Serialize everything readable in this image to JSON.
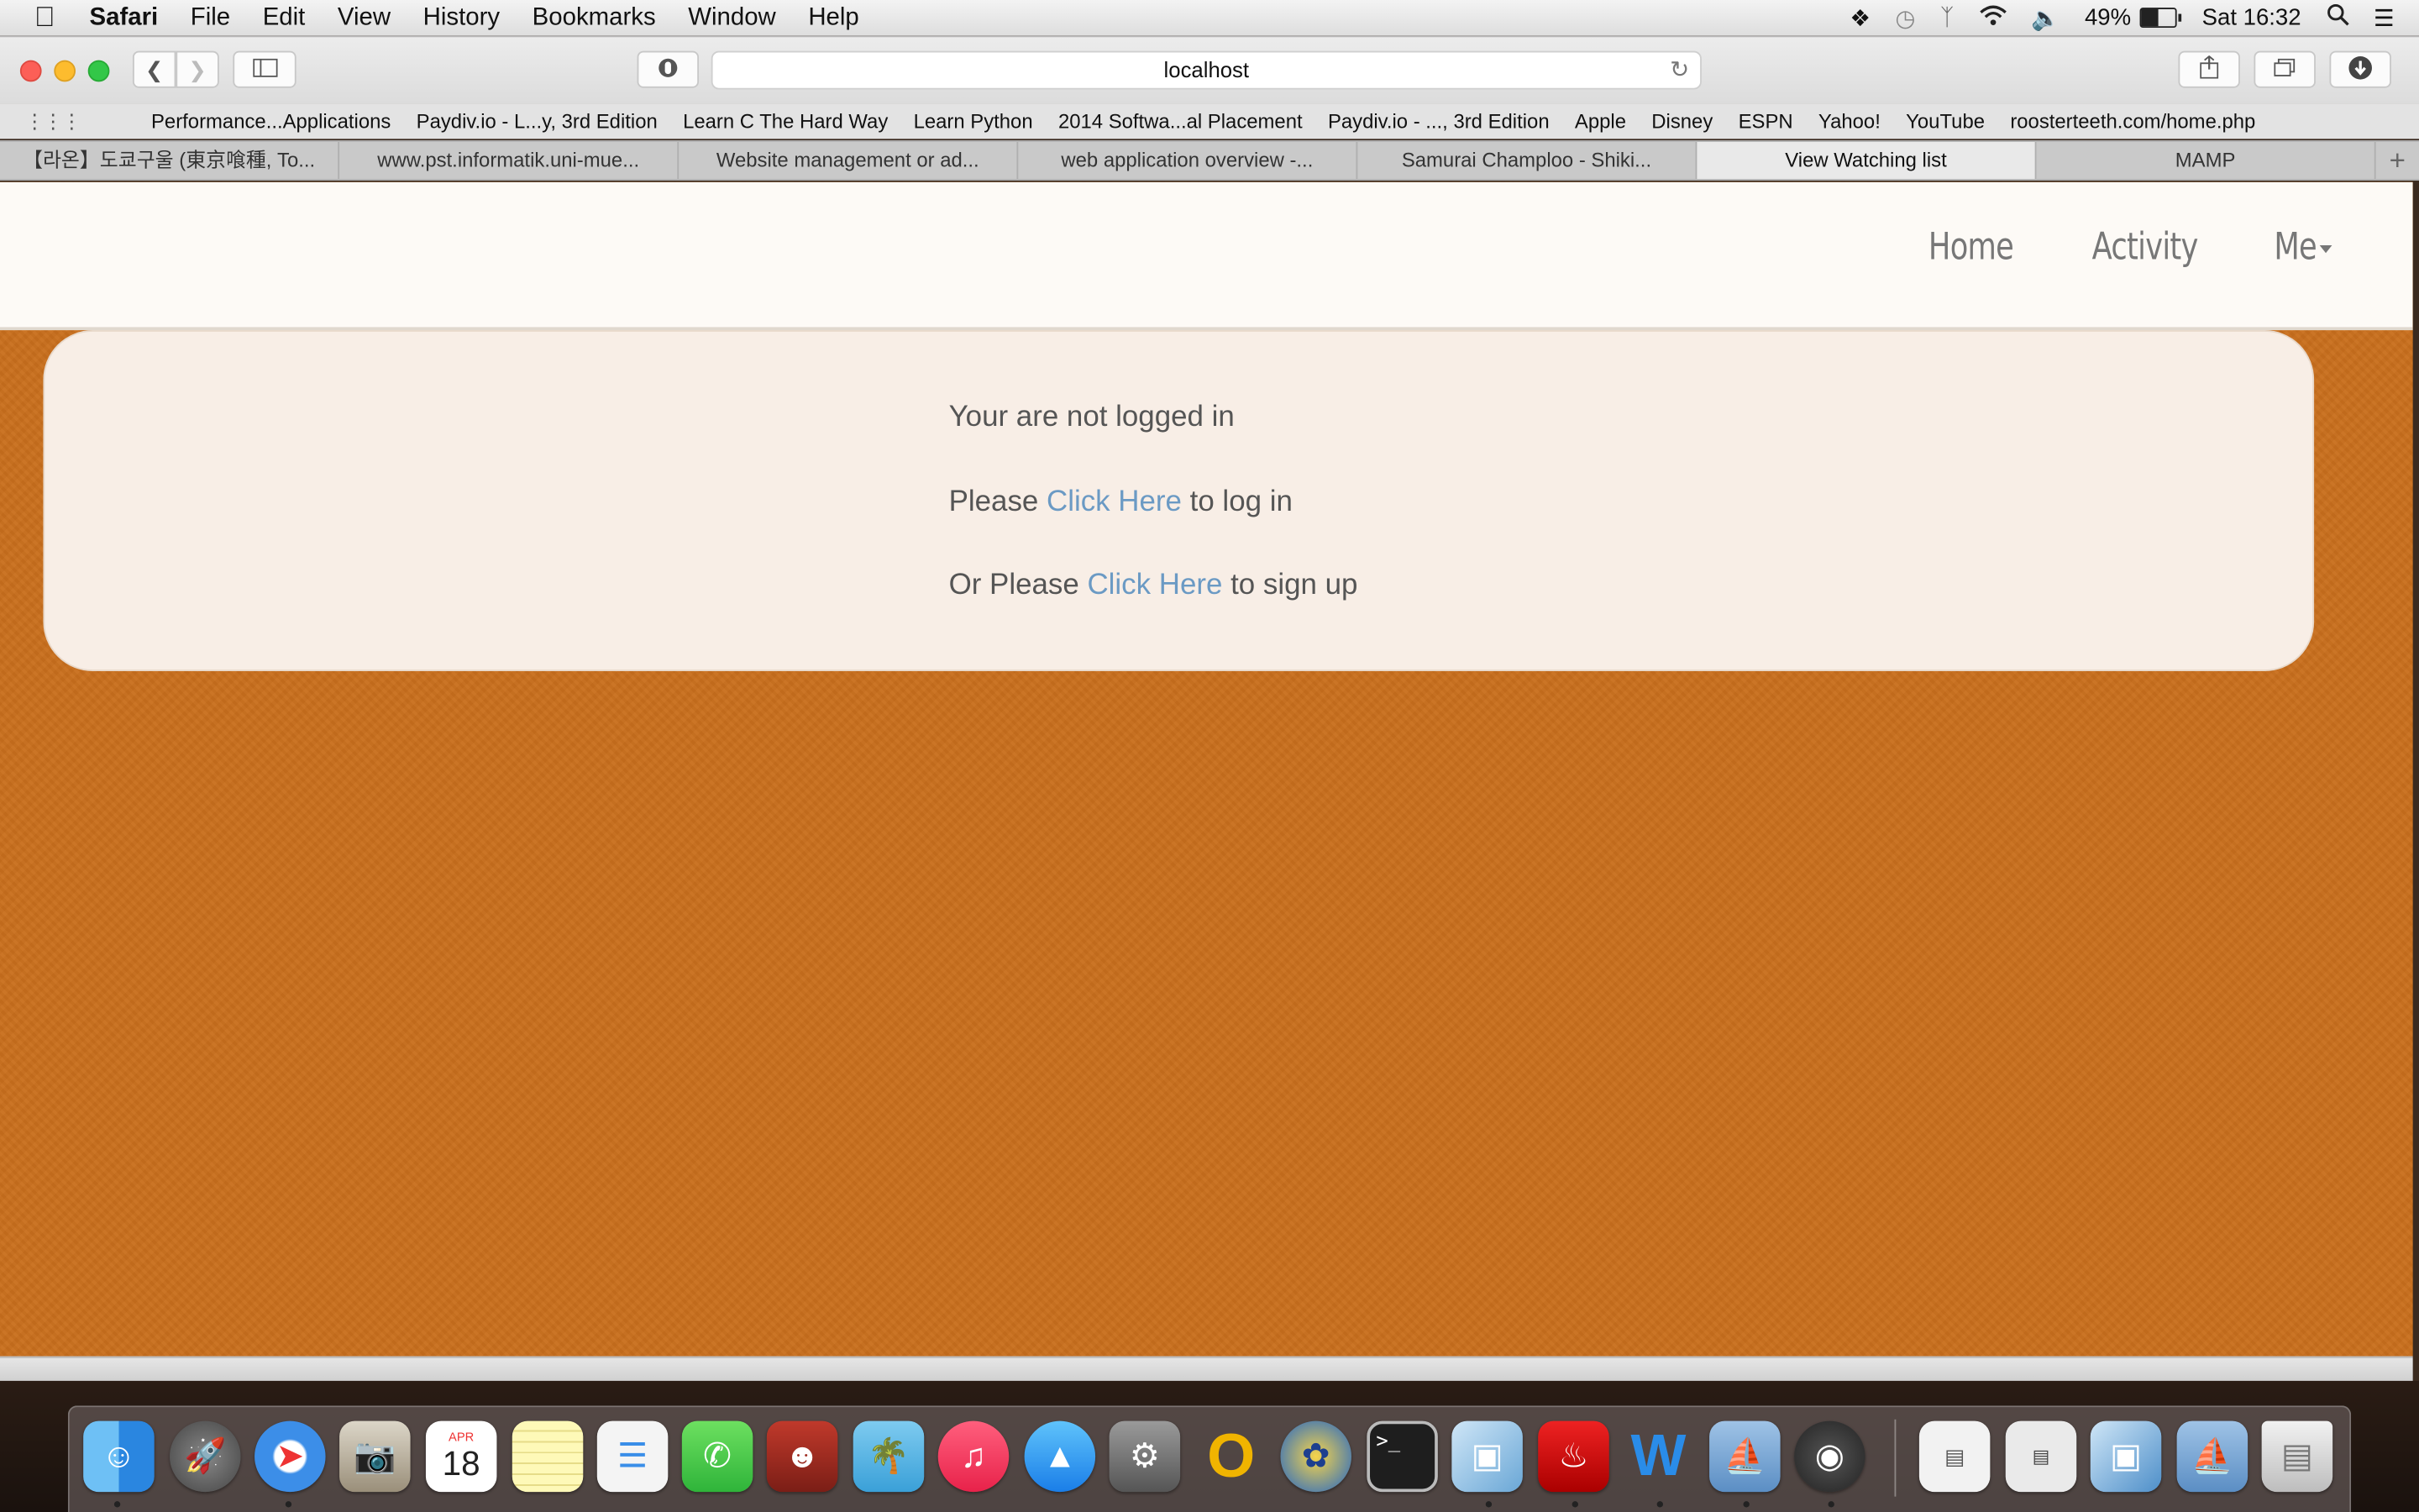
{
  "menubar": {
    "app": "Safari",
    "items": [
      "File",
      "Edit",
      "View",
      "History",
      "Bookmarks",
      "Window",
      "Help"
    ],
    "battery": "49%",
    "clock": "Sat 16:32"
  },
  "toolbar": {
    "url": "localhost"
  },
  "bookmarks": [
    "Performance...Applications",
    "Paydiv.io - L...y, 3rd Edition",
    "Learn C The Hard Way",
    "Learn Python",
    "2014 Softwa...al Placement",
    "Paydiv.io - ..., 3rd Edition",
    "Apple",
    "Disney",
    "ESPN",
    "Yahoo!",
    "YouTube",
    "roosterteeth.com/home.php"
  ],
  "tabs": [
    "【라온】도쿄구울 (東京喰種, To...",
    "www.pst.informatik.uni-mue...",
    "Website management or ad...",
    "web application overview -...",
    "Samurai Champloo - Shiki...",
    "View Watching list",
    "MAMP"
  ],
  "active_tab_index": 5,
  "nav": {
    "home": "Home",
    "activity": "Activity",
    "me": "Me"
  },
  "message": {
    "line1": "Your are not logged in",
    "line2_prefix": "Please ",
    "line2_link": "Click Here",
    "line2_suffix": " to log in",
    "line3_prefix": "Or Please ",
    "line3_link": "Click Here",
    "line3_suffix": " to sign up"
  },
  "colors": {
    "background": "#c96f1d",
    "navbar": "#fdfaf6",
    "panel": "#f8eee6",
    "link": "#6b9ac4",
    "text": "#555555"
  },
  "dock": {
    "calendar_month": "APR",
    "calendar_day": "18",
    "apps": [
      "finder-icon",
      "launchpad-icon",
      "safari-icon",
      "preview-icon",
      "calendar-icon",
      "notes-icon",
      "reminders-icon",
      "facetime-icon",
      "photo-booth-icon",
      "iphoto-icon",
      "itunes-icon",
      "app-store-icon",
      "system-preferences-icon",
      "opera-icon",
      "cyberduck-icon",
      "terminal-icon",
      "virtualbox-icon",
      "acrobat-icon",
      "word-icon",
      "paper-ship-icon",
      "mamp-icon",
      "documents-stack-icon",
      "mamp-stack-icon",
      "cube-stack-icon",
      "ship-stack-icon",
      "trash-icon"
    ]
  }
}
